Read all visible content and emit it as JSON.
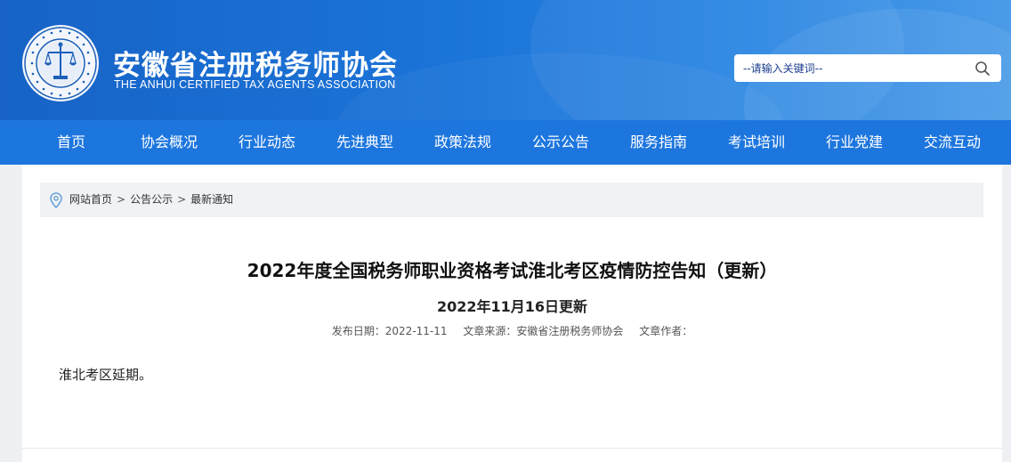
{
  "header": {
    "site_name": "安徽省注册税务师协会",
    "site_name_en": "THE ANHUI CERTIFIED TAX AGENTS ASSOCIATION",
    "logo_icon": "association-seal-icon",
    "search": {
      "placeholder": "--请输入关键词--",
      "value": "",
      "icon": "search-icon"
    }
  },
  "nav": {
    "items": [
      "首页",
      "协会概况",
      "行业动态",
      "先进典型",
      "政策法规",
      "公示公告",
      "服务指南",
      "考试培训",
      "行业党建",
      "交流互动"
    ]
  },
  "breadcrumb": {
    "icon": "location-pin-icon",
    "items": [
      "网站首页",
      "公告公示",
      "最新通知"
    ],
    "separator": ">"
  },
  "article": {
    "title": "2022年度全国税务师职业资格考试淮北考区疫情防控告知（更新）",
    "subtitle": "2022年11月16日更新",
    "meta": {
      "date": "发布日期：2022-11-11",
      "source": "文章来源：安徽省注册税务师协会",
      "author": "文章作者："
    },
    "body": "淮北考区延期。"
  },
  "colors": {
    "header_blue": "#1b74d8",
    "nav_blue": "#1d76de",
    "page_bg": "#eef0f3",
    "breadcrumb_bg": "#f0f2f5",
    "search_text": "#1c3e8e"
  }
}
